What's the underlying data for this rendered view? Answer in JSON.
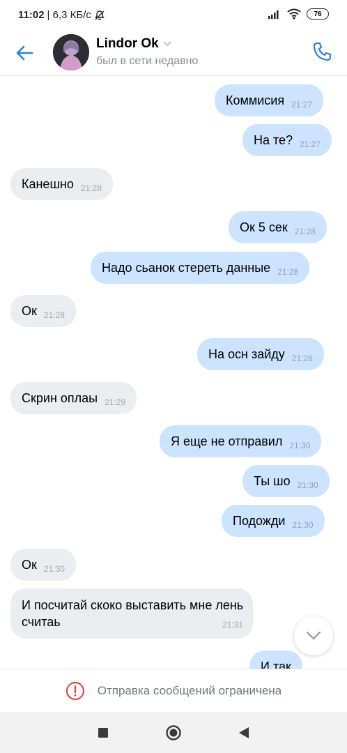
{
  "status_bar": {
    "time": "11:02",
    "speed": "| 6,3 КБ/с",
    "battery": "76"
  },
  "header": {
    "name": "Lindor Ok",
    "status": "был в сети недавно"
  },
  "messages": [
    {
      "text": "Коммисия",
      "time": "21:27",
      "dir": "out"
    },
    {
      "text": "На те?",
      "time": "21:27",
      "dir": "out"
    },
    {
      "text": "Канешно",
      "time": "21:28",
      "dir": "in"
    },
    {
      "text": "Ок 5 сек",
      "time": "21:28",
      "dir": "out"
    },
    {
      "text": "Надо сьанок стереть данные",
      "time": "21:28",
      "dir": "out"
    },
    {
      "text": "Ок",
      "time": "21:28",
      "dir": "in"
    },
    {
      "text": "На осн зайду",
      "time": "21:28",
      "dir": "out"
    },
    {
      "text": "Скрин оплаы",
      "time": "21:29",
      "dir": "in"
    },
    {
      "text": "Я еще не отправил",
      "time": "21:30",
      "dir": "out"
    },
    {
      "text": "Ты шо",
      "time": "21:30",
      "dir": "out"
    },
    {
      "text": "Подожди",
      "time": "21:30",
      "dir": "out"
    },
    {
      "text": "Ок",
      "time": "21:30",
      "dir": "in"
    },
    {
      "text": "И посчитай скоко выставить мне лень считаь",
      "time": "21:31",
      "dir": "in"
    },
    {
      "text": "И так",
      "time": "",
      "dir": "out"
    }
  ],
  "footer": {
    "restricted_text": "Отправка сообщений ограничена"
  },
  "colors": {
    "accent": "#2d81e0",
    "outgoing_bubble": "#cce4ff",
    "incoming_bubble": "#ebedf0",
    "warning": "#e64646"
  },
  "icons": {
    "back": "arrow-left-icon",
    "call": "phone-icon",
    "scroll": "chevron-down-icon",
    "warning": "exclamation-circle-icon"
  }
}
